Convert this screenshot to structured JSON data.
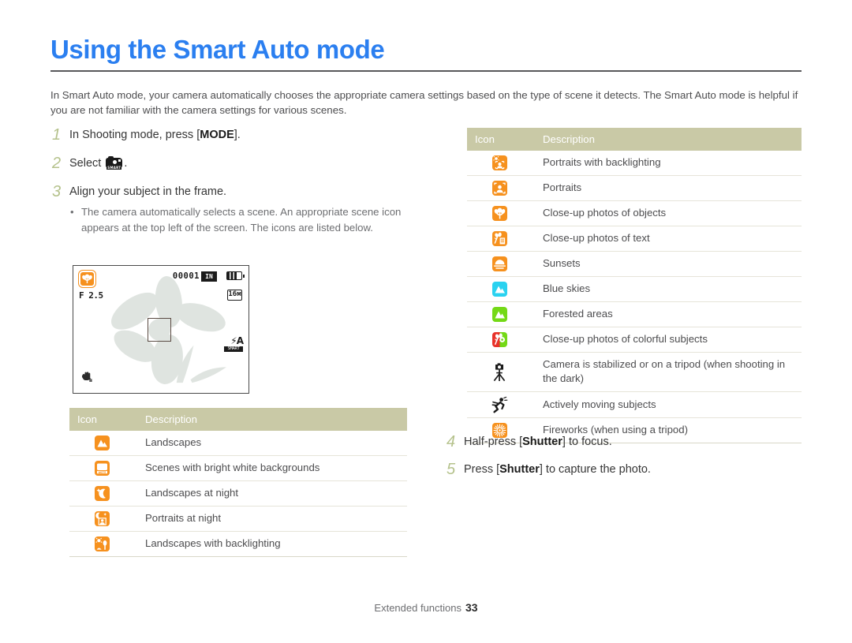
{
  "title": "Using the Smart Auto mode",
  "intro": "In Smart Auto mode, your camera automatically chooses the appropriate camera settings based on the type of scene it detects. The Smart Auto mode is helpful if you are not familiar with the camera settings for various scenes.",
  "steps": [
    {
      "num": "1",
      "pre": "In Shooting mode, press [",
      "strong": "MODE",
      "post": "]."
    },
    {
      "num": "2",
      "pre": "Select ",
      "strong": "",
      "post": "."
    },
    {
      "num": "3",
      "pre": "Align your subject in the frame.",
      "strong": "",
      "post": ""
    },
    {
      "num": "4",
      "pre": "Half-press [",
      "strong": "Shutter",
      "post": "] to focus."
    },
    {
      "num": "5",
      "pre": "Press [",
      "strong": "Shutter",
      "post": "] to capture the photo."
    }
  ],
  "bullet": "The camera automatically selects a scene. An appropriate scene icon appears at the top left of the screen. The icons are listed below.",
  "lcd": {
    "aperture": "F 2.5",
    "counter": "00001",
    "iso_chip": "IN",
    "resolution": "16м",
    "flash_label": "A",
    "flash_sub": "SMART",
    "scene_icon": "macro-flower-icon",
    "battery_icon": "battery-full-icon",
    "ois_icon": "ois-hand-icon",
    "af_frame": "af-frame"
  },
  "table_headers": {
    "icon": "Icon",
    "description": "Description"
  },
  "table_left": {
    "rows": [
      {
        "icon": "landscape-icon",
        "desc": "Landscapes"
      },
      {
        "icon": "white-background-icon",
        "desc": "Scenes with bright white backgrounds"
      },
      {
        "icon": "night-landscape-icon",
        "desc": "Landscapes at night"
      },
      {
        "icon": "night-portrait-icon",
        "desc": "Portraits at night"
      },
      {
        "icon": "backlit-landscape-icon",
        "desc": "Landscapes with backlighting"
      }
    ]
  },
  "table_right": {
    "rows": [
      {
        "icon": "backlit-portrait-icon",
        "desc": "Portraits with backlighting"
      },
      {
        "icon": "portrait-icon",
        "desc": "Portraits"
      },
      {
        "icon": "macro-object-icon",
        "desc": "Close-up photos of objects"
      },
      {
        "icon": "macro-text-icon",
        "desc": "Close-up photos of text"
      },
      {
        "icon": "sunset-icon",
        "desc": "Sunsets"
      },
      {
        "icon": "blue-sky-icon",
        "desc": "Blue skies"
      },
      {
        "icon": "forest-icon",
        "desc": "Forested areas"
      },
      {
        "icon": "macro-color-icon",
        "desc": "Close-up photos of colorful subjects"
      },
      {
        "icon": "tripod-icon",
        "desc": "Camera is stabilized or on a tripod (when shooting in the dark)"
      },
      {
        "icon": "action-icon",
        "desc": "Actively moving subjects"
      },
      {
        "icon": "fireworks-icon",
        "desc": "Fireworks (when using a tripod)"
      }
    ]
  },
  "footer": {
    "section": "Extended functions",
    "page": "33"
  },
  "colors": {
    "heading_blue": "#2b7ff0",
    "table_header_olive": "#c9c9a6",
    "step_number_green": "#b5c28c",
    "icon_orange": "#f6911e",
    "icon_cyan": "#2ad2f0",
    "icon_green": "#74d916",
    "icon_red": "#e8322a"
  }
}
